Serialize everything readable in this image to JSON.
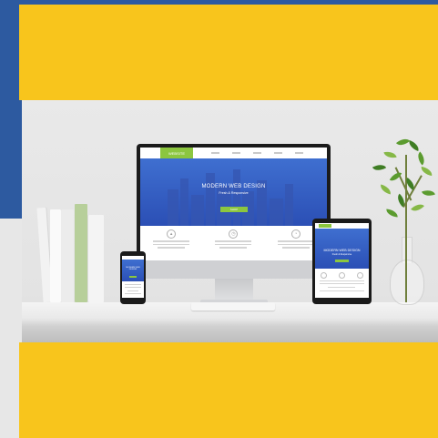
{
  "monitor_site": {
    "logo_text": "WEBSITE",
    "hero_title": "MODERN WEB DESIGN",
    "hero_subtitle": "Fresh & Responsive",
    "cta_label": "SHOP"
  },
  "tablet_site": {
    "hero_title": "MODERN WEB DESIGN",
    "hero_subtitle": "Fresh & Responsive"
  },
  "phone_site": {
    "hero_title": "MODERN WEB DESIGN"
  },
  "colors": {
    "brand_blue": "#2d5aa0",
    "accent_yellow": "#f8c51c",
    "site_green": "#8cc63f",
    "site_hero_blue": "#3f6fd0"
  },
  "icons": {
    "feature_icons": [
      "chart-icon",
      "clock-icon",
      "pie-icon"
    ]
  }
}
